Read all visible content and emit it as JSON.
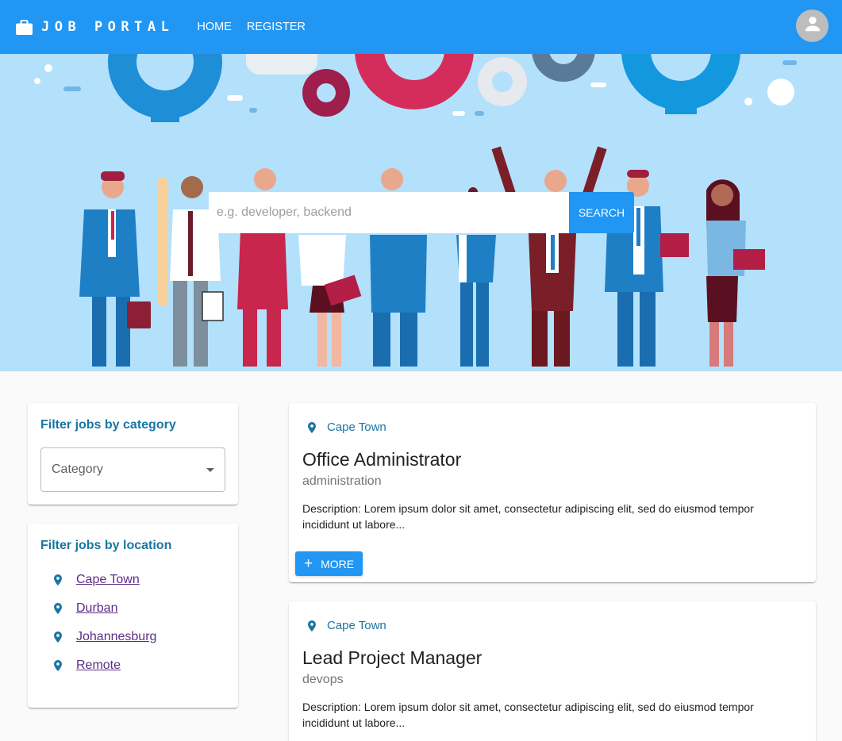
{
  "header": {
    "brand": "JOB PORTAL",
    "brand_icon": "briefcase-icon",
    "nav": [
      {
        "label": "HOME"
      },
      {
        "label": "REGISTER"
      }
    ],
    "avatar_icon": "account-icon",
    "color": "#2196f3"
  },
  "hero": {
    "search_placeholder": "e.g. developer, backend",
    "search_button": "SEARCH",
    "background": "#b3e0fb"
  },
  "filters": {
    "category": {
      "title": "Filter jobs by category",
      "select_placeholder": "Category"
    },
    "location": {
      "title": "Filter jobs by location",
      "items": [
        {
          "label": "Cape Town"
        },
        {
          "label": "Durban"
        },
        {
          "label": "Johannesburg"
        },
        {
          "label": "Remote"
        }
      ]
    }
  },
  "jobs": [
    {
      "location": "Cape Town",
      "title": "Office Administrator",
      "category": "administration",
      "description": "Description: Lorem ipsum dolor sit amet, consectetur adipiscing elit, sed do eiusmod tempor incididunt ut labore...",
      "more_label": "MORE"
    },
    {
      "location": "Cape Town",
      "title": "Lead Project Manager",
      "category": "devops",
      "description": "Description: Lorem ipsum dolor sit amet, consectetur adipiscing elit, sed do eiusmod tempor incididunt ut labore..."
    }
  ]
}
